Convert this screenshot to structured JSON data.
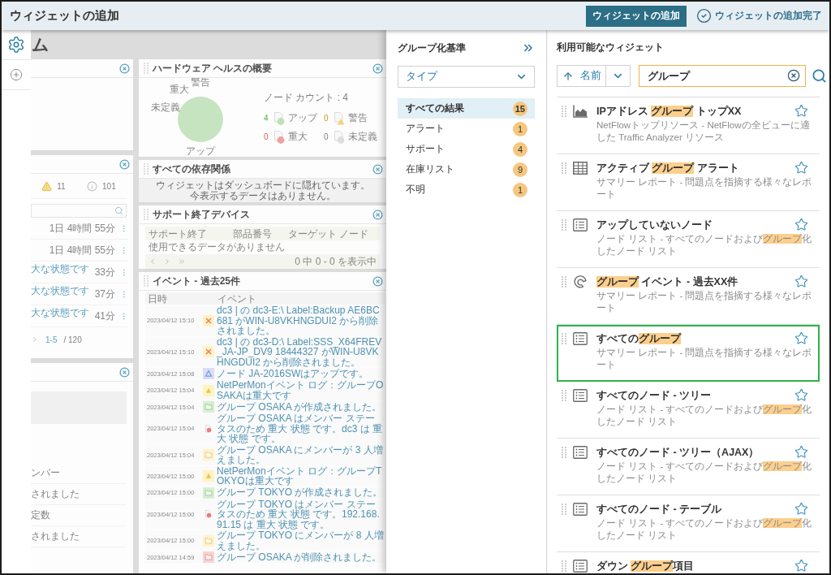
{
  "header": {
    "title": "ウィジェットの追加",
    "buttons": [
      {
        "kind": "primary",
        "label": "ウィジェットの追加"
      },
      {
        "kind": "done",
        "label": "ウィジェットの追加完了"
      }
    ]
  },
  "sidebar": {
    "items": [
      {
        "kind": "settings",
        "selected": true
      },
      {
        "kind": "add",
        "selected": false
      }
    ]
  },
  "dashboard": {
    "title": "ム",
    "left_widgets": [
      {
        "kind": "empty"
      },
      {
        "kind": "alerts",
        "counts": [
          {
            "kind": "warning",
            "value": "11"
          },
          {
            "kind": "info",
            "value": "101"
          }
        ],
        "rows": [
          {
            "time": "1日 4時間 55分"
          },
          {
            "time": "1日 4時間 55分"
          },
          {
            "text": "大な状態です",
            "time": "33分"
          },
          {
            "text": "大な状態です",
            "time": "37分"
          },
          {
            "text": "大な状態です",
            "time": "41分"
          }
        ],
        "pager": {
          "range": "1-5",
          "total": "/ 120"
        }
      },
      {
        "kind": "list",
        "lines": [
          "ンバー",
          "されました",
          "定数",
          "されました"
        ]
      }
    ],
    "right_widgets": [
      {
        "kind": "health",
        "title": "ハードウェア ヘルスの概要",
        "chart_data": {
          "type": "pie",
          "categories": [
            "警告",
            "重大",
            "未定義",
            "アップ"
          ],
          "values": [
            0,
            0,
            0,
            100
          ]
        },
        "count_label": "ノード カウント : 4",
        "legend": [
          {
            "kind": "up",
            "count": "4",
            "label": "アップ"
          },
          {
            "kind": "warning",
            "count": "0",
            "label": "警告"
          },
          {
            "kind": "critical",
            "count": "0",
            "label": "重大"
          },
          {
            "kind": "unknown",
            "count": "0",
            "label": "未定義"
          }
        ]
      },
      {
        "kind": "message",
        "title": "すべての依存関係",
        "lines": [
          "ウィジェットはダッシュボードに隠れています。",
          "今表示するデータはありません。"
        ]
      },
      {
        "kind": "table",
        "title": "サポート終了デバイス",
        "columns": [
          "サポート終了",
          "部品番号",
          "ターゲット ノード"
        ],
        "empty_text": "使用できるデータがありません",
        "pager_text": "0 中 0 - 0 を表示中"
      },
      {
        "kind": "events",
        "title": "イベント - 過去25件",
        "columns": [
          "日時",
          "イベント"
        ],
        "rows": [
          {
            "time": "2023/04/12 15:10",
            "kind": "deleted",
            "text": "dc3 | の dc3-E:\\ Label:Backup AE6BC681 がWIN-U8VKHNGDUI2 から削除されました。"
          },
          {
            "time": "2023/04/12 15:10",
            "kind": "deleted",
            "text": "dc3 | の dc3-D:\\ Label:SSS_X64FREV_JA-JP_DV9 18444327 がWIN-U8VKHNGDUI2 から削除されました。"
          },
          {
            "time": "2023/04/12 15:08",
            "kind": "node-up",
            "text": "ノード JA-2016SWはアップです。"
          },
          {
            "time": "2023/04/12 15:04",
            "kind": "warning",
            "text": "NetPerMonイベント ログ：グループOSAKAは重大です"
          },
          {
            "time": "2023/04/12 15:04",
            "kind": "group-created",
            "text": "グループ OSAKA が作成されました。"
          },
          {
            "time": "2023/04/12 15:04",
            "kind": "critical",
            "text": "グループ OSAKA はメンバー ステータスのため 重大 状態 です。dc3 は 重大 状態 です。"
          },
          {
            "time": "2023/04/12 15:04",
            "kind": "member-added",
            "text": "グループ OSAKA にメンバーが 3 人増えました。"
          },
          {
            "time": "2023/04/12 15:00",
            "kind": "warning",
            "text": "NetPerMonイベント ログ：グループTOKYOは重大です"
          },
          {
            "time": "2023/04/12 15:00",
            "kind": "group-created",
            "text": "グループ TOKYO が作成されました。"
          },
          {
            "time": "2023/04/12 15:00",
            "kind": "critical",
            "text": "グループ TOKYO はメンバー ステータスのため 重大 状態 です。192.168.91.15 は 重大 状態 です。"
          },
          {
            "time": "2023/04/12 15:00",
            "kind": "member-added",
            "text": "グループ TOKYO にメンバーが 8 人増えました。"
          },
          {
            "time": "2023/04/12 14:59",
            "kind": "group-deleted",
            "text": "グループ OSAKA が削除されました。"
          }
        ]
      }
    ]
  },
  "group_panel": {
    "title": "グループ化基準",
    "dropdown": {
      "value": "タイプ"
    },
    "groups": [
      {
        "label": "すべての結果",
        "count": "15",
        "selected": true
      },
      {
        "label": "アラート",
        "count": "1",
        "selected": false
      },
      {
        "label": "サポート",
        "count": "4",
        "selected": false
      },
      {
        "label": "在庫リスト",
        "count": "9",
        "selected": false
      },
      {
        "label": "不明",
        "count": "1",
        "selected": false
      }
    ]
  },
  "widgets_panel": {
    "title": "利用可能なウィジェット",
    "sort": {
      "label": "名前",
      "ascending": true
    },
    "search": {
      "value": "グループ"
    },
    "items": [
      {
        "kind": "area-chart",
        "title": [
          {
            "text": "IPアドレス ",
            "match": false
          },
          {
            "text": "グループ",
            "match": true
          },
          {
            "text": " トップXX",
            "match": false
          }
        ],
        "description": [
          {
            "text": "NetFlowトップリソース - NetFlowの全ビューに適した Traffic Analyzer リソース",
            "match": false
          }
        ],
        "starred": false,
        "selected": false
      },
      {
        "kind": "table",
        "title": [
          {
            "text": "アクティブ ",
            "match": false
          },
          {
            "text": "グループ",
            "match": true
          },
          {
            "text": " アラート",
            "match": false
          }
        ],
        "description": [
          {
            "text": "サマリー レポート - 問題点を指摘する様々なレポート",
            "match": false
          }
        ],
        "starred": false,
        "selected": false
      },
      {
        "kind": "list",
        "title": [
          {
            "text": "アップしていないノード",
            "match": false
          }
        ],
        "description": [
          {
            "text": "ノード リスト - すべてのノードおよび",
            "match": false
          },
          {
            "text": "グループ",
            "match": true
          },
          {
            "text": "化したノード リスト",
            "match": false
          }
        ],
        "starred": false,
        "selected": false
      },
      {
        "kind": "arc",
        "title": [
          {
            "text": "グループ",
            "match": true
          },
          {
            "text": " イベント - 過去XX件",
            "match": false
          }
        ],
        "description": [
          {
            "text": "サマリー レポート - 問題点を指摘する様々なレポート",
            "match": false
          }
        ],
        "starred": false,
        "selected": false
      },
      {
        "kind": "list",
        "title": [
          {
            "text": "すべての",
            "match": false
          },
          {
            "text": "グループ",
            "match": true
          }
        ],
        "description": [
          {
            "text": "サマリー レポート - 問題点を指摘する様々なレポート",
            "match": false
          }
        ],
        "starred": false,
        "selected": true
      },
      {
        "kind": "list",
        "title": [
          {
            "text": "すべてのノード - ツリー",
            "match": false
          }
        ],
        "description": [
          {
            "text": "ノード リスト - すべてのノードおよび",
            "match": false
          },
          {
            "text": "グループ",
            "match": true
          },
          {
            "text": "化したノード リスト",
            "match": false
          }
        ],
        "starred": false,
        "selected": false
      },
      {
        "kind": "list",
        "title": [
          {
            "text": "すべてのノード - ツリー（AJAX）",
            "match": false
          }
        ],
        "description": [
          {
            "text": "ノード リスト - すべてのノードおよび",
            "match": false
          },
          {
            "text": "グループ",
            "match": true
          },
          {
            "text": "化したノード リスト",
            "match": false
          }
        ],
        "starred": false,
        "selected": false
      },
      {
        "kind": "list",
        "title": [
          {
            "text": "すべてのノード - テーブル",
            "match": false
          }
        ],
        "description": [
          {
            "text": "ノード リスト - すべてのノードおよび",
            "match": false
          },
          {
            "text": "グループ",
            "match": true
          },
          {
            "text": "化したノード リスト",
            "match": false
          }
        ],
        "starred": false,
        "selected": false
      },
      {
        "kind": "list",
        "title": [
          {
            "text": "ダウン ",
            "match": false
          },
          {
            "text": "グループ",
            "match": true
          },
          {
            "text": "項目",
            "match": false
          }
        ],
        "starred": false,
        "selected": false
      }
    ]
  }
}
